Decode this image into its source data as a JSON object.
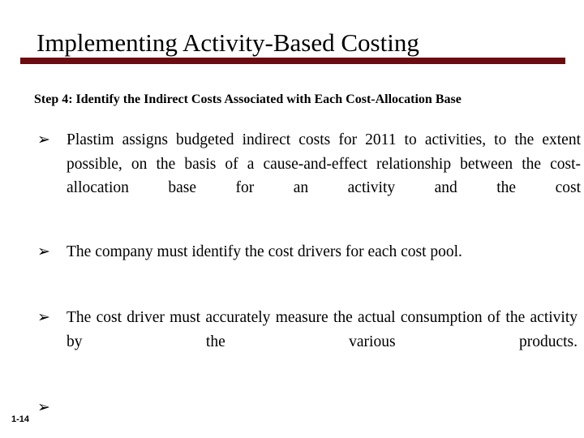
{
  "slide": {
    "title": "Implementing Activity-Based Costing",
    "accent_color": "#6B0C10",
    "background_color": "#FFFFFF",
    "text_color": "#000000",
    "subtitle": "Step 4: Identify the Indirect Costs Associated with Each Cost-Allocation Base",
    "bullet_marker": "➢",
    "bullets": [
      {
        "marker": "➢",
        "text": "Plastim assigns budgeted indirect costs for 2011 to activities, to the extent possible, on the basis of a cause-and-effect relationship between the cost-allocation base for an activity and the cost"
      },
      {
        "marker": "➢",
        "text": "The company must identify the cost drivers for each cost pool."
      },
      {
        "marker": "➢",
        "text": "The cost driver must accurately measure the actual consumption of the activity by the various products."
      },
      {
        "marker": "➢",
        "text": ""
      }
    ],
    "page_number": "1-14"
  }
}
